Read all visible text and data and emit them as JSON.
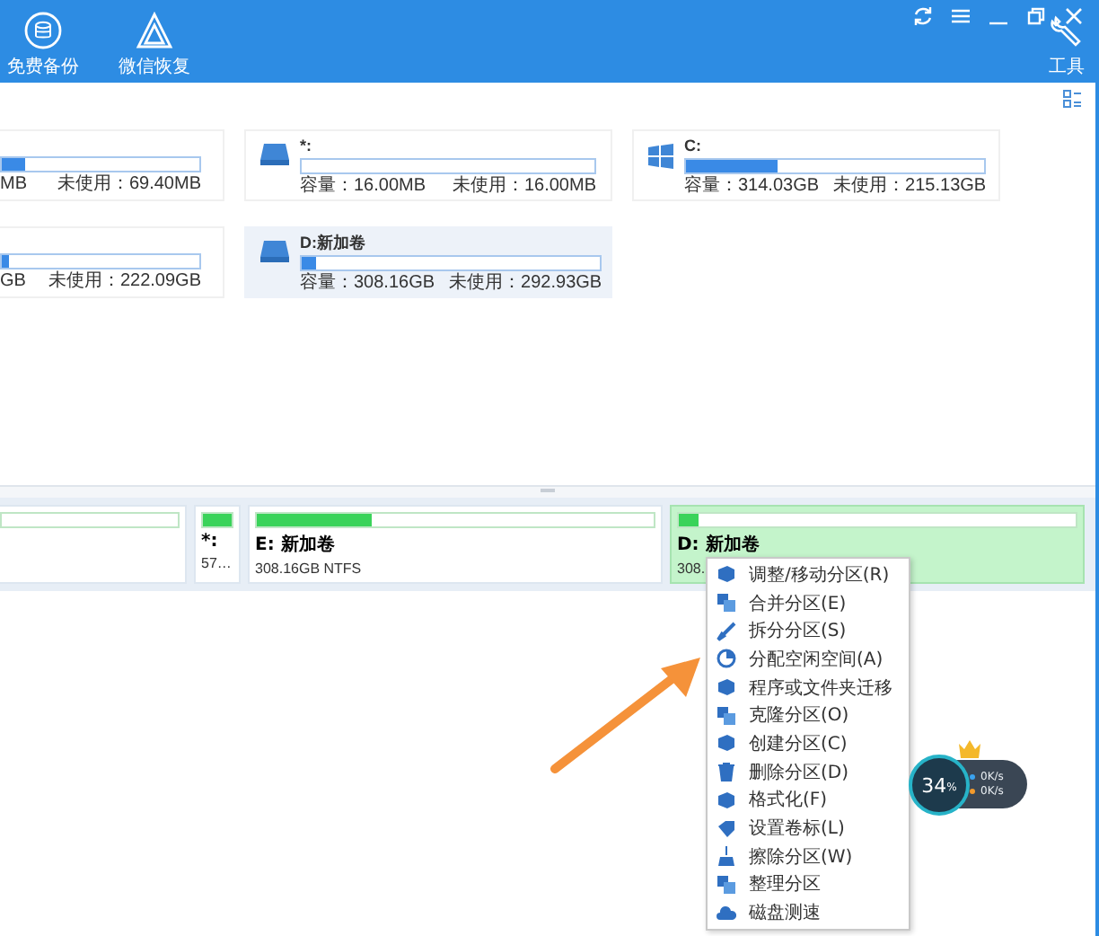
{
  "toolbar": {
    "left": [
      {
        "label": "免费备份",
        "kind": "backup"
      },
      {
        "label": "微信恢复",
        "kind": "wechat"
      }
    ],
    "right": {
      "label": "工具"
    }
  },
  "disk_cards": [
    {
      "kind": "partial",
      "capacity": "MB",
      "unused": "未使用：69.40MB",
      "level": 0.12,
      "selected": false
    },
    {
      "kind": "drive",
      "name": "*:",
      "capacity": "容量：16.00MB",
      "unused": "未使用：16.00MB",
      "level": 0,
      "selected": false
    },
    {
      "kind": "system",
      "name": "C:",
      "capacity": "容量：314.03GB",
      "unused": "未使用：215.13GB",
      "level": 0.31,
      "selected": false
    },
    {
      "kind": "partial",
      "capacity": "GB",
      "unused": "未使用：222.09GB",
      "level": 0.04,
      "selected": false
    },
    {
      "kind": "drive",
      "name": "D:新加卷",
      "capacity": "容量：308.16GB",
      "unused": "未使用：292.93GB",
      "level": 0.05,
      "selected": true
    }
  ],
  "partitions": [
    {
      "level": 0,
      "selected": false
    },
    {
      "name": "*:",
      "info": "57…",
      "level": 1,
      "selected": false
    },
    {
      "name": "E: 新加卷",
      "info": "308.16GB NTFS",
      "level": 0.29,
      "selected": false
    },
    {
      "name": "D: 新加卷",
      "info": "308.",
      "level": 0.05,
      "selected": true
    }
  ],
  "context_menu": [
    {
      "label": "调整/移动分区(R)",
      "kind": "disk"
    },
    {
      "label": "合并分区(E)",
      "kind": "copy"
    },
    {
      "label": "拆分分区(S)",
      "kind": "brush"
    },
    {
      "label": "分配空闲空间(A)",
      "kind": "pie"
    },
    {
      "label": "程序或文件夹迁移",
      "kind": "disk"
    },
    {
      "label": "克隆分区(O)",
      "kind": "copy"
    },
    {
      "label": "创建分区(C)",
      "kind": "disk"
    },
    {
      "label": "删除分区(D)",
      "kind": "trash"
    },
    {
      "label": "格式化(F)",
      "kind": "disk"
    },
    {
      "label": "设置卷标(L)",
      "kind": "tag"
    },
    {
      "label": "擦除分区(W)",
      "kind": "broom"
    },
    {
      "label": "整理分区",
      "kind": "copy"
    },
    {
      "label": "磁盘测速",
      "kind": "cloud"
    }
  ],
  "speed_widget": {
    "percent": "34",
    "unit": "%",
    "upload": "0K/s",
    "download": "0K/s"
  }
}
